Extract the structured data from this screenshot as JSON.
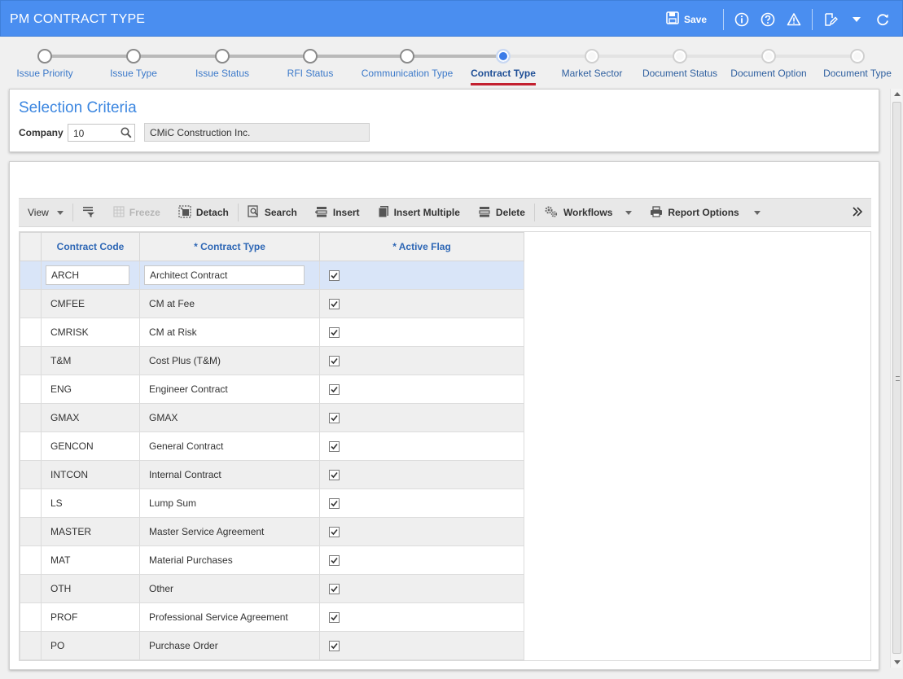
{
  "header": {
    "title": "PM CONTRACT TYPE",
    "save_label": "Save",
    "icons": [
      "save-icon",
      "info-icon",
      "help-icon",
      "warning-icon",
      "edit-note-icon",
      "chevron-down-icon",
      "refresh-icon"
    ]
  },
  "train": {
    "steps": [
      {
        "label": "Issue Priority",
        "state": "done"
      },
      {
        "label": "Issue Type",
        "state": "done"
      },
      {
        "label": "Issue Status",
        "state": "done"
      },
      {
        "label": "RFI Status",
        "state": "done"
      },
      {
        "label": "Communication Type",
        "state": "done"
      },
      {
        "label": "Contract Type",
        "state": "active"
      },
      {
        "label": "Market Sector",
        "state": "todo"
      },
      {
        "label": "Document Status",
        "state": "todo"
      },
      {
        "label": "Document Option",
        "state": "todo"
      },
      {
        "label": "Document Type",
        "state": "todo"
      }
    ]
  },
  "selection": {
    "heading": "Selection Criteria",
    "company_label": "Company",
    "company_code": "10",
    "company_name": "CMiC Construction Inc."
  },
  "toolbar": {
    "view": "View",
    "freeze": "Freeze",
    "detach": "Detach",
    "search": "Search",
    "insert": "Insert",
    "insert_multiple": "Insert Multiple",
    "delete": "Delete",
    "workflows": "Workflows",
    "report_options": "Report Options"
  },
  "grid": {
    "columns": [
      "Contract Code",
      "* Contract Type",
      "* Active Flag"
    ],
    "rows": [
      {
        "code": "ARCH",
        "type": "Architect Contract",
        "active": true
      },
      {
        "code": "CMFEE",
        "type": "CM at Fee",
        "active": true
      },
      {
        "code": "CMRISK",
        "type": "CM at Risk",
        "active": true
      },
      {
        "code": "T&M",
        "type": "Cost Plus (T&M)",
        "active": true
      },
      {
        "code": "ENG",
        "type": "Engineer Contract",
        "active": true
      },
      {
        "code": "GMAX",
        "type": "GMAX",
        "active": true
      },
      {
        "code": "GENCON",
        "type": "General Contract",
        "active": true
      },
      {
        "code": "INTCON",
        "type": "Internal Contract",
        "active": true
      },
      {
        "code": "LS",
        "type": "Lump Sum",
        "active": true
      },
      {
        "code": "MASTER",
        "type": "Master Service Agreement",
        "active": true
      },
      {
        "code": "MAT",
        "type": "Material Purchases",
        "active": true
      },
      {
        "code": "OTH",
        "type": "Other",
        "active": true
      },
      {
        "code": "PROF",
        "type": "Professional Service Agreement",
        "active": true
      },
      {
        "code": "PO",
        "type": "Purchase Order",
        "active": true
      }
    ]
  },
  "colors": {
    "header_bg": "#4a8ef0",
    "accent": "#3b86e0",
    "active_underline": "#c3202f",
    "selected_row": "#d9e5f8"
  }
}
